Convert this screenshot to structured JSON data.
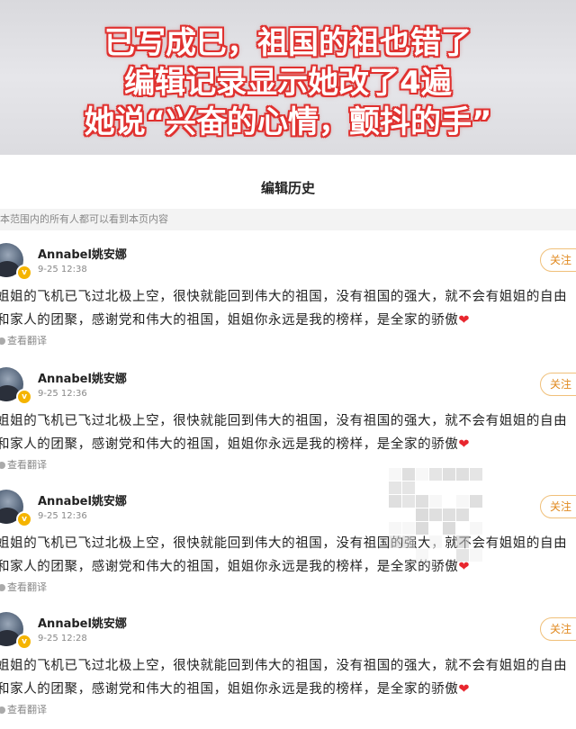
{
  "banner": {
    "line1": "已写成巳，祖国的祖也错了",
    "line2": "编辑记录显示她改了4遍",
    "line3": "她说“兴奋的心情，颤抖的手”"
  },
  "page": {
    "title": "编辑历史",
    "notice": "本范围内的所有人都可以看到本页内容"
  },
  "entries": [
    {
      "username": "Annabel姚安娜",
      "time": "9-25 12:38",
      "follow": "关注",
      "line1": "姐姐的飞机已飞过北极上空，很快就能回到伟大的祖国，没有祖国的强大，就不会有姐姐的自由",
      "line2": "和家人的团聚，感谢党和伟大的祖国，姐姐你永远是我的榜样，是全家的骄傲",
      "heart": "❤",
      "translate": "查看翻译"
    },
    {
      "username": "Annabel姚安娜",
      "time": "9-25 12:36",
      "follow": "关注",
      "line1": "姐姐的飞机已飞过北极上空，很快就能回到伟大的祖国，没有祖国的强大，就不会有姐姐的自由",
      "line2": "和家人的团聚，感谢党和伟大的祖国，姐姐你永远是我的榜样，是全家的骄傲",
      "heart": "❤",
      "translate": "查看翻译"
    },
    {
      "username": "Annabel姚安娜",
      "time": "9-25 12:36",
      "follow": "关注",
      "line1": "姐姐的飞机已飞过北极上空，很快就能回到伟大的祖国，没有祖国的强大，就不会有姐姐的自由",
      "line2": "和家人的团聚，感谢党和伟大的祖国，姐姐你永远是我的榜样，是全家的骄傲",
      "heart": "❤",
      "translate": "查看翻译"
    },
    {
      "username": "Annabel姚安娜",
      "time": "9-25 12:28",
      "follow": "关注",
      "line1": "姐姐的飞机已飞过北极上空，很快就能回到伟大的祖国，没有祖国的强大，就不会有姐姐的自由",
      "line2": "和家人的团聚，感谢党和伟大的祖国，姐姐你永远是我的榜样，是全家的骄傲",
      "heart": "❤",
      "translate": "查看翻译"
    }
  ],
  "colors": {
    "banner_outline": "#e0312f",
    "follow_accent": "#e0891e",
    "heart": "#e8262e",
    "verified_badge": "#f5b400"
  },
  "icons": [
    "verified-badge-icon",
    "heart-icon",
    "translate-icon"
  ]
}
